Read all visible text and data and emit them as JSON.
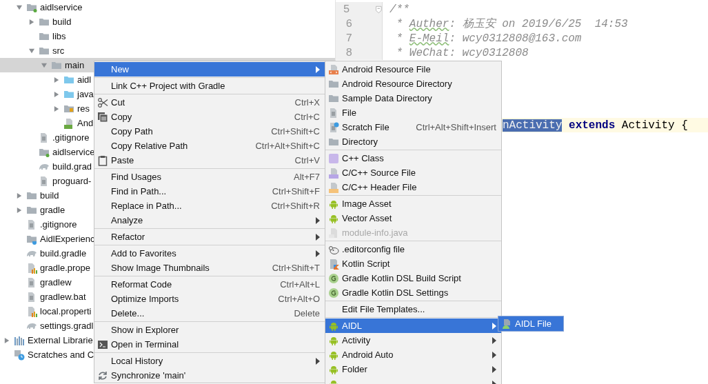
{
  "project_tree": {
    "root_children": [
      {
        "label": "aidlservice",
        "kind": "module",
        "expanded": true,
        "selected": false,
        "children": [
          {
            "label": "build",
            "kind": "folder",
            "expanded": false,
            "selected": false
          },
          {
            "label": "libs",
            "kind": "folder",
            "selected": false
          },
          {
            "label": "src",
            "kind": "folder",
            "expanded": true,
            "selected": false,
            "children": [
              {
                "label": "main",
                "kind": "folder",
                "expanded": true,
                "selected": true,
                "children": [
                  {
                    "label": "aidl",
                    "kind": "source-folder",
                    "expanded": false,
                    "selected": false
                  },
                  {
                    "label": "java",
                    "kind": "source-folder",
                    "expanded": false,
                    "selected": false
                  },
                  {
                    "label": "res",
                    "kind": "res-folder",
                    "expanded": false,
                    "selected": false
                  },
                  {
                    "label": "And",
                    "kind": "manifest",
                    "selected": false
                  }
                ]
              }
            ]
          },
          {
            "label": ".gitignore",
            "kind": "text-file",
            "selected": false
          },
          {
            "label": "aidlservice",
            "kind": "module-file",
            "selected": false
          },
          {
            "label": "build.grad",
            "kind": "gradle",
            "selected": false
          },
          {
            "label": "proguard-",
            "kind": "text-file",
            "selected": false
          }
        ]
      },
      {
        "label": "build",
        "kind": "folder",
        "expanded": false,
        "selected": false
      },
      {
        "label": "gradle",
        "kind": "folder",
        "expanded": false,
        "selected": false
      },
      {
        "label": ".gitignore",
        "kind": "text-file",
        "selected": false
      },
      {
        "label": "AidlExperienc",
        "kind": "project-file",
        "selected": false
      },
      {
        "label": "build.gradle",
        "kind": "gradle",
        "selected": false
      },
      {
        "label": "gradle.prope",
        "kind": "properties",
        "selected": false
      },
      {
        "label": "gradlew",
        "kind": "text-file",
        "selected": false
      },
      {
        "label": "gradlew.bat",
        "kind": "text-file",
        "selected": false
      },
      {
        "label": "local.properti",
        "kind": "properties",
        "selected": false
      },
      {
        "label": "settings.gradl",
        "kind": "gradle",
        "selected": false
      }
    ],
    "items": [
      {
        "label": "External Librarie",
        "kind": "libraries",
        "expanded": false,
        "selected": false
      },
      {
        "label": "Scratches and C",
        "kind": "scratches",
        "selected": false
      }
    ]
  },
  "editor": {
    "lines": [
      {
        "number": "5",
        "fold": true,
        "segments": [
          {
            "text": "/**",
            "kind": "comment"
          }
        ]
      },
      {
        "number": "6",
        "fold": false,
        "segments": [
          {
            "text": " * ",
            "kind": "comment"
          },
          {
            "text": "Auther",
            "kind": "typo"
          },
          {
            "text": ": 杨玉安 on 2019/6/25  14:53",
            "kind": "comment"
          }
        ]
      },
      {
        "number": "7",
        "fold": false,
        "segments": [
          {
            "text": " * ",
            "kind": "comment"
          },
          {
            "text": "E-Meil",
            "kind": "typo"
          },
          {
            "text": ": wcy0312808@163.com",
            "kind": "comment"
          }
        ]
      },
      {
        "number": "8",
        "fold": false,
        "segments": [
          {
            "text": " * WeChat: wcy0312808",
            "kind": "comment"
          }
        ]
      }
    ],
    "caret_line": {
      "segments": [
        {
          "text": "nActivity",
          "kind": "selected"
        },
        {
          "text": " extends",
          "kind": "keyword"
        },
        {
          "text": " Activity {",
          "kind": "plain"
        }
      ]
    }
  },
  "context_menu": {
    "groups": [
      [
        {
          "label": "New",
          "submenu": true,
          "selected": true
        }
      ],
      [
        {
          "label": "Link C++ Project with Gradle",
          "submenu": false,
          "selected": false
        }
      ],
      [
        {
          "label": "Cut",
          "kind": "cut",
          "shortcut": "Ctrl+X",
          "submenu": false,
          "selected": false
        },
        {
          "label": "Copy",
          "kind": "copy",
          "shortcut": "Ctrl+C",
          "submenu": false,
          "selected": false
        },
        {
          "label": "Copy Path",
          "shortcut": "Ctrl+Shift+C",
          "submenu": false,
          "selected": false
        },
        {
          "label": "Copy Relative Path",
          "shortcut": "Ctrl+Alt+Shift+C",
          "submenu": false,
          "selected": false
        },
        {
          "label": "Paste",
          "kind": "paste",
          "shortcut": "Ctrl+V",
          "submenu": false,
          "selected": false
        }
      ],
      [
        {
          "label": "Find Usages",
          "shortcut": "Alt+F7",
          "submenu": false,
          "selected": false
        },
        {
          "label": "Find in Path...",
          "shortcut": "Ctrl+Shift+F",
          "submenu": false,
          "selected": false
        },
        {
          "label": "Replace in Path...",
          "shortcut": "Ctrl+Shift+R",
          "submenu": false,
          "selected": false
        },
        {
          "label": "Analyze",
          "submenu": true,
          "selected": false
        }
      ],
      [
        {
          "label": "Refactor",
          "submenu": true,
          "selected": false
        }
      ],
      [
        {
          "label": "Add to Favorites",
          "submenu": true,
          "selected": false
        },
        {
          "label": "Show Image Thumbnails",
          "shortcut": "Ctrl+Shift+T",
          "submenu": false,
          "selected": false
        }
      ],
      [
        {
          "label": "Reformat Code",
          "shortcut": "Ctrl+Alt+L",
          "submenu": false,
          "selected": false
        },
        {
          "label": "Optimize Imports",
          "shortcut": "Ctrl+Alt+O",
          "submenu": false,
          "selected": false
        },
        {
          "label": "Delete...",
          "shortcut": "Delete",
          "submenu": false,
          "selected": false
        }
      ],
      [
        {
          "label": "Show in Explorer",
          "submenu": false,
          "selected": false
        },
        {
          "label": "Open in Terminal",
          "kind": "terminal",
          "submenu": false,
          "selected": false
        }
      ],
      [
        {
          "label": "Local History",
          "submenu": true,
          "selected": false
        },
        {
          "label": "Synchronize 'main'",
          "kind": "sync",
          "submenu": false,
          "selected": false
        }
      ]
    ]
  },
  "new_submenu": {
    "groups": [
      [
        {
          "label": "Android Resource File",
          "kind": "res-file",
          "submenu": false,
          "selected": false,
          "disabled": false
        },
        {
          "label": "Android Resource Directory",
          "kind": "folder",
          "submenu": false,
          "selected": false,
          "disabled": false
        },
        {
          "label": "Sample Data Directory",
          "kind": "folder",
          "submenu": false,
          "selected": false,
          "disabled": false
        },
        {
          "label": "File",
          "kind": "file",
          "submenu": false,
          "selected": false,
          "disabled": false
        },
        {
          "label": "Scratch File",
          "kind": "scratch",
          "shortcut": "Ctrl+Alt+Shift+Insert",
          "submenu": false,
          "selected": false,
          "disabled": false
        },
        {
          "label": "Directory",
          "kind": "folder",
          "submenu": false,
          "selected": false,
          "disabled": false
        }
      ],
      [
        {
          "label": "C++ Class",
          "kind": "cpp-class",
          "submenu": false,
          "selected": false,
          "disabled": false
        },
        {
          "label": "C/C++ Source File",
          "kind": "cpp-source",
          "submenu": false,
          "selected": false,
          "disabled": false
        },
        {
          "label": "C/C++ Header File",
          "kind": "cpp-header",
          "submenu": false,
          "selected": false,
          "disabled": false
        }
      ],
      [
        {
          "label": "Image Asset",
          "kind": "android",
          "submenu": false,
          "selected": false,
          "disabled": false
        },
        {
          "label": "Vector Asset",
          "kind": "android",
          "submenu": false,
          "selected": false,
          "disabled": false
        },
        {
          "label": "module-info.java",
          "kind": "java-file",
          "submenu": false,
          "selected": false,
          "disabled": true
        }
      ],
      [
        {
          "label": ".editorconfig file",
          "kind": "editorconfig",
          "submenu": false,
          "selected": false,
          "disabled": false
        },
        {
          "label": "Kotlin Script",
          "kind": "kotlin",
          "submenu": false,
          "selected": false,
          "disabled": false
        },
        {
          "label": "Gradle Kotlin DSL Build Script",
          "kind": "gradle-badge",
          "submenu": false,
          "selected": false,
          "disabled": false
        },
        {
          "label": "Gradle Kotlin DSL Settings",
          "kind": "gradle-badge",
          "submenu": false,
          "selected": false,
          "disabled": false
        }
      ],
      [
        {
          "label": "Edit File Templates...",
          "submenu": false,
          "selected": false,
          "disabled": false
        }
      ],
      [
        {
          "label": "AIDL",
          "kind": "android",
          "submenu": true,
          "selected": true,
          "disabled": false
        },
        {
          "label": "Activity",
          "kind": "android",
          "submenu": true,
          "selected": false,
          "disabled": false
        },
        {
          "label": "Android Auto",
          "kind": "android",
          "submenu": true,
          "selected": false,
          "disabled": false
        },
        {
          "label": "Folder",
          "kind": "android",
          "submenu": true,
          "selected": false,
          "disabled": false
        },
        {
          "kind": "android",
          "submenu": true,
          "selected": false,
          "disabled": false
        }
      ]
    ]
  },
  "aidl_submenu": {
    "items": [
      {
        "label": "AIDL File",
        "kind": "aidl-file",
        "selected": true
      }
    ]
  }
}
